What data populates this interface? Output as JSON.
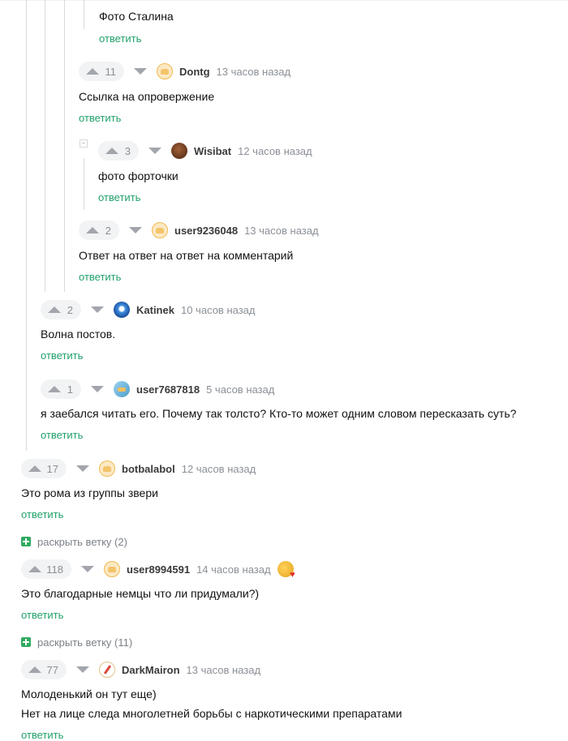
{
  "thread": {
    "reply_label": "ответить",
    "comments": [
      {
        "text": "Фото Сталина"
      },
      {
        "votes": "11",
        "author": "Dontg",
        "time": "13 часов назад",
        "text": "Ссылка на опровержение"
      },
      {
        "votes": "3",
        "author": "Wisibat",
        "time": "12 часов назад",
        "text": "фото форточки"
      },
      {
        "votes": "2",
        "author": "user9236048",
        "time": "13 часов назад",
        "text": "Ответ на ответ на ответ на комментарий"
      },
      {
        "votes": "2",
        "author": "Katinek",
        "time": "10 часов назад",
        "text": "Волна постов."
      },
      {
        "votes": "1",
        "author": "user7687818",
        "time": "5 часов назад",
        "text": "я заебался читать его. Почему так толсто? Кто-то может одним словом пересказать суть?"
      },
      {
        "votes": "17",
        "author": "botbalabol",
        "time": "12 часов назад",
        "text": "Это рома из группы звери"
      },
      {
        "votes": "118",
        "author": "user8994591",
        "time": "14 часов назад",
        "text": "Это благодарные немцы что ли придумали?)"
      },
      {
        "votes": "77",
        "author": "DarkMairon",
        "time": "13 часов назад",
        "text_line1": "Молоденький он тут еще)",
        "text_line2": "Нет на лице следа многолетней борьбы с наркотическими препаратами"
      }
    ],
    "expand_1": "раскрыть ветку (2)",
    "expand_2": "раскрыть ветку (11)"
  },
  "icons": {
    "upvote": "arrow-up-icon",
    "downvote": "arrow-down-icon",
    "expand": "plus-square-icon",
    "collapse": "minus-square-icon"
  },
  "colors": {
    "reply_link": "#21a16a",
    "expand_plus": "#2faa5f",
    "meta_text": "#8b9096"
  }
}
